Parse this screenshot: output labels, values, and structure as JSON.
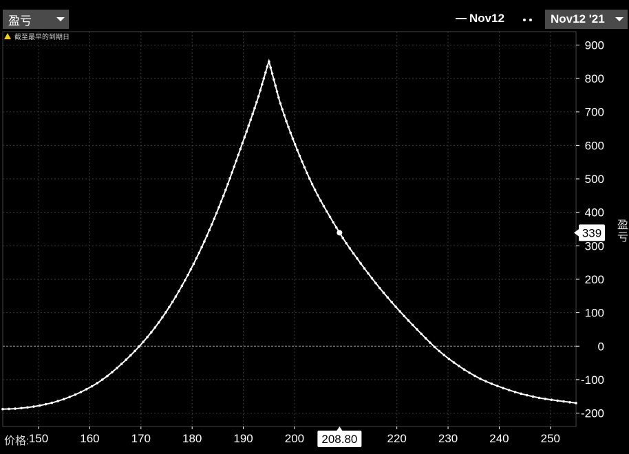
{
  "header": {
    "metric_dropdown_label": "盈亏",
    "legend_line_label": "Nov12",
    "date_dropdown_label": "Nov12 '21"
  },
  "warning_text": "截至最早的到期日",
  "x_axis_prefix": "价格:",
  "y_axis_title": "盈亏",
  "cursor": {
    "x_label": "208.80",
    "y_label": "339"
  },
  "colors": {
    "background": "#000000",
    "line": "#ffffff",
    "grid": "#3a3a3a",
    "warning": "#f2d300",
    "dropdown": "#4a4a4a"
  },
  "chart_data": {
    "type": "line",
    "xlim": [
      143,
      255
    ],
    "ylim": [
      -240,
      940
    ],
    "x_ticks": [
      150,
      160,
      170,
      180,
      190,
      200,
      220,
      230,
      240,
      250
    ],
    "y_ticks": [
      900,
      800,
      700,
      600,
      500,
      400,
      300,
      200,
      100,
      0,
      -100,
      -200
    ],
    "cursor_point": {
      "x": 208.8,
      "y": 339
    },
    "series": [
      {
        "name": "Nov12",
        "x": [
          143,
          146,
          150,
          154,
          158,
          162,
          166,
          170,
          174,
          178,
          182,
          186,
          190,
          193,
          195,
          197,
          200,
          204,
          208.8,
          212,
          216,
          220,
          224,
          228,
          232,
          236,
          240,
          244,
          248,
          252,
          255
        ],
        "y": [
          -188,
          -186,
          -178,
          -163,
          -139,
          -105,
          -56,
          5,
          82,
          180,
          300,
          445,
          614,
          748,
          852,
          737,
          607,
          467,
          339,
          267,
          186,
          114,
          49,
          -11,
          -58,
          -95,
          -121,
          -141,
          -155,
          -164,
          -170
        ]
      }
    ]
  }
}
